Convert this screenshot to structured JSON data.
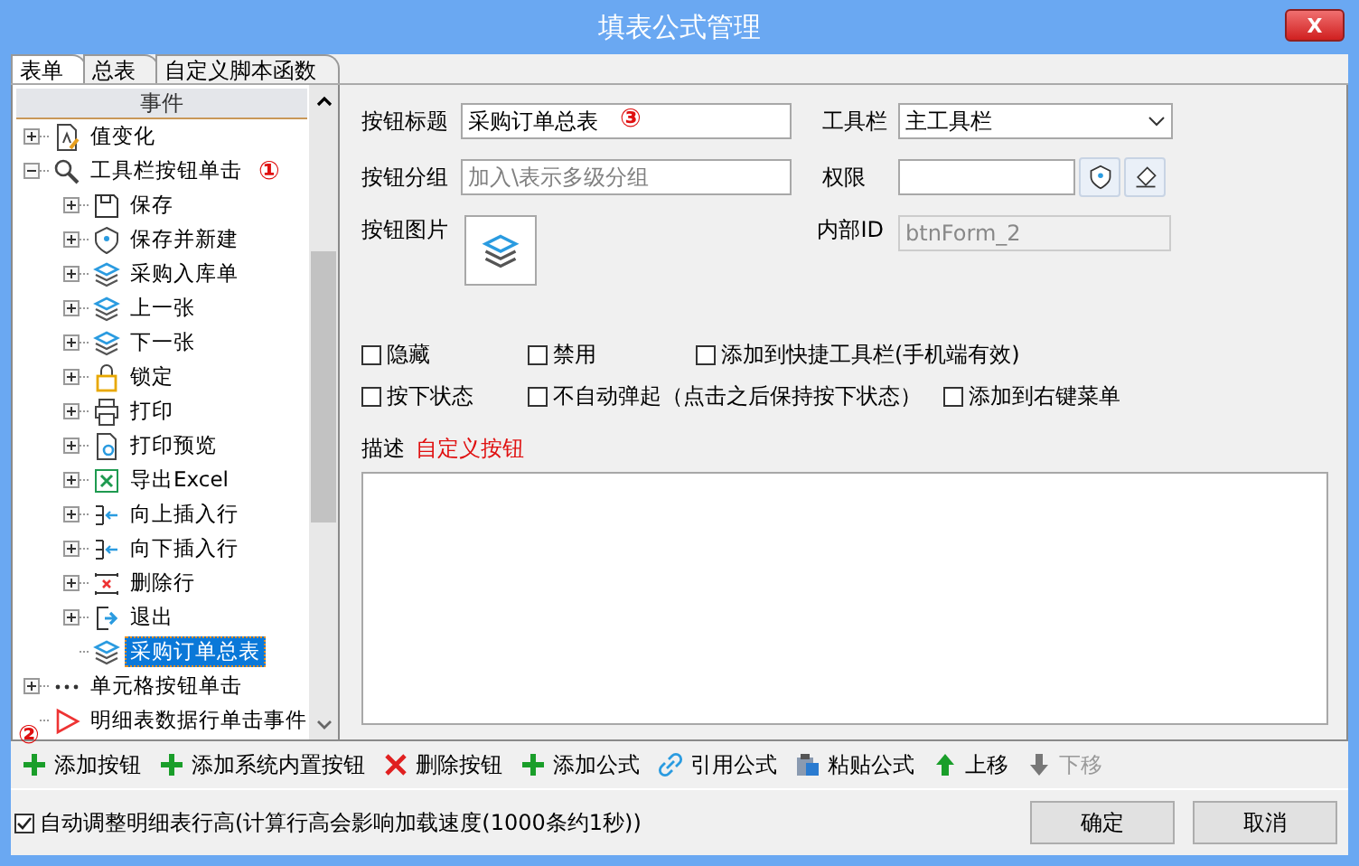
{
  "window": {
    "title": "填表公式管理",
    "close": "X"
  },
  "tabs": [
    {
      "label": "表单",
      "selected": true
    },
    {
      "label": "总表",
      "selected": false
    },
    {
      "label": "自定义脚本函数",
      "selected": false
    }
  ],
  "tree": {
    "header": "事件",
    "items": [
      {
        "label": "值变化",
        "expanded": false,
        "selected": false
      },
      {
        "label": "工具栏按钮单击",
        "expanded": true,
        "selected": false,
        "marker": "①",
        "children": [
          {
            "label": "保存",
            "expanded": false,
            "selected": false
          },
          {
            "label": "保存并新建",
            "expanded": false,
            "selected": false
          },
          {
            "label": "采购入库单",
            "expanded": false,
            "selected": false
          },
          {
            "label": "上一张",
            "expanded": false,
            "selected": false
          },
          {
            "label": "下一张",
            "expanded": false,
            "selected": false
          },
          {
            "label": "锁定",
            "expanded": false,
            "selected": false
          },
          {
            "label": "打印",
            "expanded": false,
            "selected": false
          },
          {
            "label": "打印预览",
            "expanded": false,
            "selected": false
          },
          {
            "label": "导出Excel",
            "expanded": false,
            "selected": false
          },
          {
            "label": "向上插入行",
            "expanded": false,
            "selected": false
          },
          {
            "label": "向下插入行",
            "expanded": false,
            "selected": false
          },
          {
            "label": "删除行",
            "expanded": false,
            "selected": false
          },
          {
            "label": "退出",
            "expanded": false,
            "selected": false
          },
          {
            "label": "采购订单总表",
            "selected": true
          }
        ]
      },
      {
        "label": "单元格按钮单击",
        "expanded": false,
        "selected": false
      },
      {
        "label": "明细表数据行单击事件",
        "selected": false
      }
    ]
  },
  "form": {
    "title_label": "按钮标题",
    "title_value": "采购订单总表",
    "title_marker": "③",
    "toolbar_label": "工具栏",
    "toolbar_value": "主工具栏",
    "group_label": "按钮分组",
    "group_placeholder": "加入\\表示多级分组",
    "permission_label": "权限",
    "image_label": "按钮图片",
    "id_label": "内部ID",
    "id_value": "btnForm_2",
    "checkbox_rows": [
      [
        {
          "label": "隐藏",
          "checked": false
        },
        {
          "label": "禁用",
          "checked": false
        },
        {
          "label": "添加到快捷工具栏(手机端有效)",
          "checked": false
        }
      ],
      [
        {
          "label": "按下状态",
          "checked": false
        },
        {
          "label": "不自动弹起（点击之后保持按下状态）",
          "checked": false
        },
        {
          "label": "添加到右键菜单",
          "checked": false
        }
      ]
    ],
    "description_label": "描述",
    "description_value": "自定义按钮"
  },
  "toolbar": {
    "marker": "②",
    "items": [
      {
        "label": "添加按钮",
        "disabled": false
      },
      {
        "label": "添加系统内置按钮",
        "disabled": false
      },
      {
        "label": "删除按钮",
        "disabled": false
      },
      {
        "label": "添加公式",
        "disabled": false
      },
      {
        "label": "引用公式",
        "disabled": false
      },
      {
        "label": "粘贴公式",
        "disabled": false
      },
      {
        "label": "上移",
        "disabled": false
      },
      {
        "label": "下移",
        "disabled": true
      }
    ]
  },
  "footer": {
    "option": {
      "label": "自动调整明细表行高(计算行高会影响加载速度(1000条约1秒))",
      "checked": true
    },
    "buttons": [
      "确定",
      "取消"
    ]
  }
}
